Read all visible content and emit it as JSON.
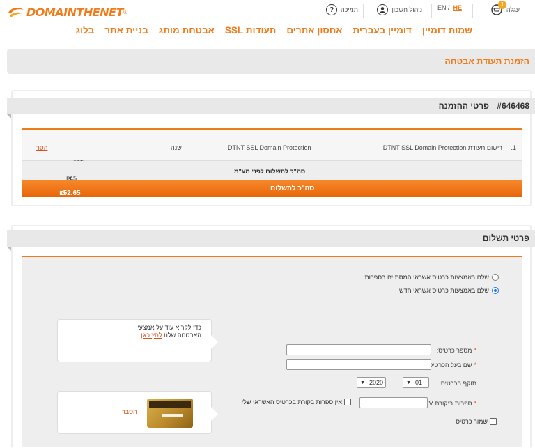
{
  "brand": {
    "logo_text_1": "DOMAIN",
    "logo_text_2": "THENET",
    "reg": "®"
  },
  "topbar": {
    "support": "תמיכה",
    "account": "ניהול חשבון",
    "lang_en": "EN /",
    "lang_he": "HE",
    "cart": "עגלה",
    "cart_count": "1"
  },
  "nav": [
    "שמות דומיין",
    "דומיין בעברית",
    "אחסון אתרים",
    "תעודות SSL",
    "אבטחת מותג",
    "בניית אתר",
    "בלוג"
  ],
  "page_title": "הזמנת תעודת אבטחה",
  "order": {
    "title": "פרטי ההזמנה",
    "number": "#646468",
    "item": {
      "index": "1.",
      "description": "רישום תעודת DTNT SSL Domain Protection",
      "product": "DTNT SSL Domain Protection",
      "period": "שנה",
      "price": "45",
      "currency": "₪",
      "remove": "הסר"
    },
    "subtotal_label": "סה\"כ לתשלום לפני מע\"מ",
    "subtotal_value": "45",
    "total_label": "סה\"כ לתשלום",
    "total_value": "52.65"
  },
  "payment": {
    "title": "פרטי תשלום",
    "option_saved": "שלם באמצעות כרטיס אשראי המסתיים בספרות",
    "option_new": "שלם באמצעות כרטיס אשראי חדש",
    "card_number_label": "מספר כרטיס:",
    "card_holder_label": "שם בעל הכרטיס:",
    "expiry_label": "תוקף הכרטיס:",
    "expiry_month": "01",
    "expiry_year": "2020",
    "cvv_label": "ספרות ביקורת CVV:",
    "no_cvv_label": "אין ספרות בקורת בכרטיס האשראי שלי",
    "save_card_label": "שמור כרטיס",
    "required_mark": "*",
    "security_tip": "כדי לקרוא עוד על אמצעי האבטחה שלנו",
    "security_tip_link": "לחץ כאן",
    "security_tip_end": ".",
    "cvv_explain": "הסבר"
  }
}
